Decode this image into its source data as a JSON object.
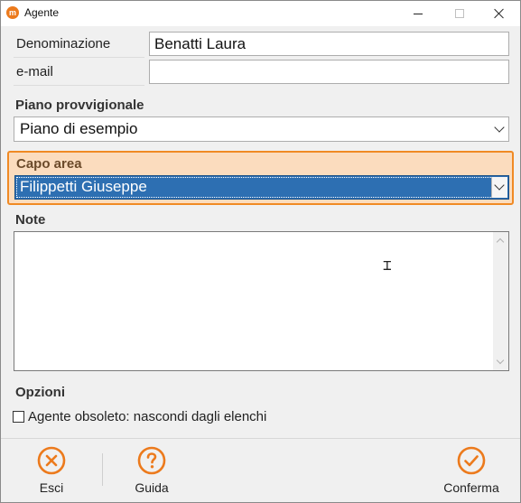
{
  "window": {
    "title": "Agente",
    "app_icon_glyph": "m",
    "accent_color": "#ec7a1c"
  },
  "fields": {
    "denominazione": {
      "label": "Denominazione",
      "value": "Benatti Laura"
    },
    "email": {
      "label": "e-mail",
      "value": ""
    }
  },
  "piano": {
    "label": "Piano provvigionale",
    "selected": "Piano di esempio"
  },
  "capo_area": {
    "label": "Capo area",
    "selected": "Filippetti Giuseppe",
    "highlight_color": "#fbdcbe",
    "border_color": "#f08a24",
    "selection_color": "#2d6fb2"
  },
  "note": {
    "label": "Note",
    "value": ""
  },
  "opzioni": {
    "label": "Opzioni",
    "obsoleto_label": "Agente obsoleto: nascondi dagli elenchi",
    "obsoleto_checked": false
  },
  "footer": {
    "esci": {
      "label": "Esci",
      "icon": "close-circle-icon"
    },
    "guida": {
      "label": "Guida",
      "icon": "help-circle-icon"
    },
    "conferma": {
      "label": "Conferma",
      "icon": "check-circle-icon"
    }
  }
}
